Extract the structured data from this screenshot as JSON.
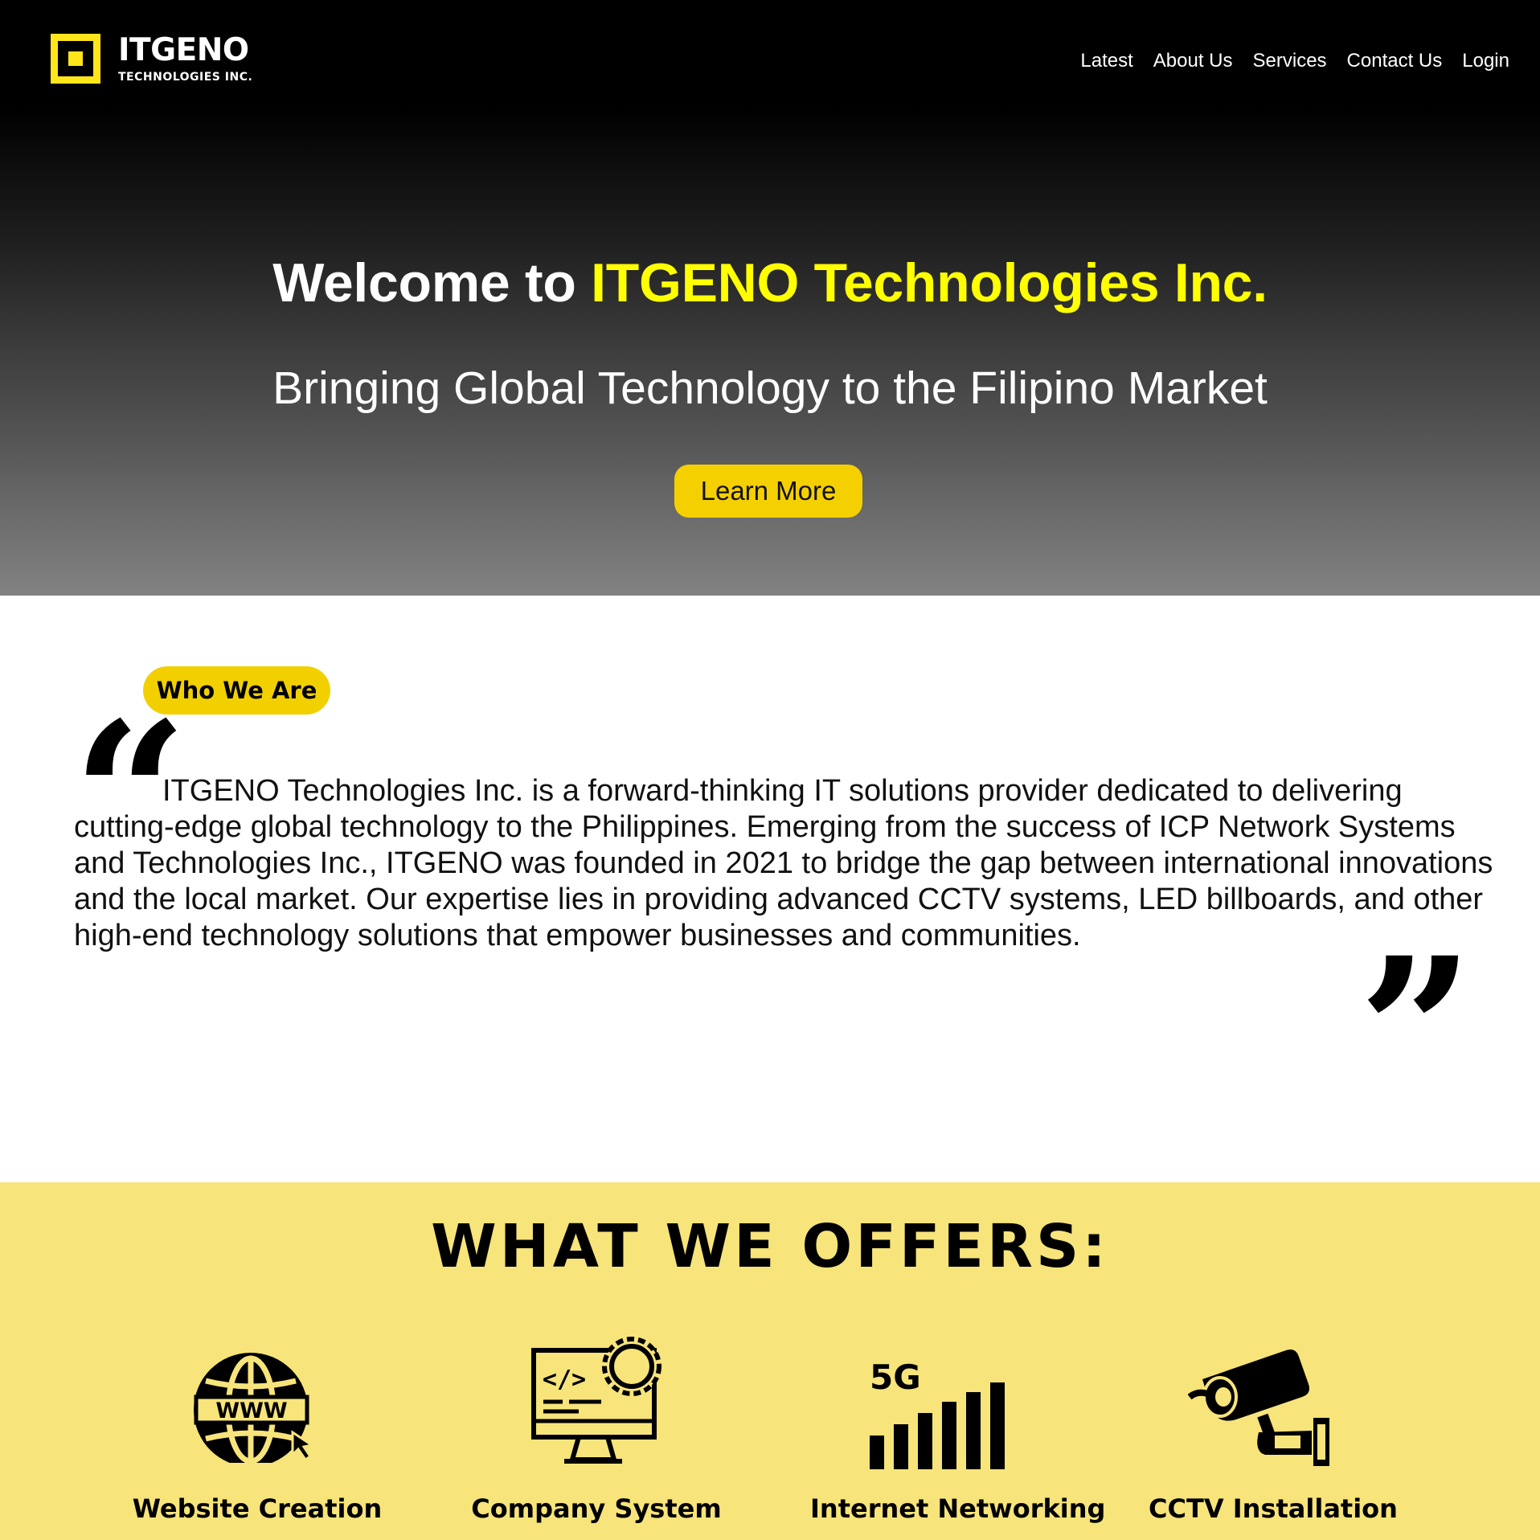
{
  "header": {
    "logo_name": "ITGENO",
    "logo_sub": "TECHNOLOGIES INC.",
    "nav": [
      "Latest",
      "About Us",
      "Services",
      "Contact Us",
      "Login"
    ]
  },
  "hero": {
    "title_prefix": "Welcome to ",
    "title_highlight": "ITGENO Technologies Inc.",
    "subtitle": "Bringing Global Technology to the Filipino Market",
    "cta": "Learn More"
  },
  "about": {
    "badge": "Who We Are",
    "text": "ITGENO Technologies Inc. is a forward-thinking IT solutions provider dedicated to delivering cutting-edge global technology to the Philippines. Emerging from the success of ICP Network Systems and Technologies Inc., ITGENO was founded in 2021 to bridge the gap between international innovations and the local market. Our expertise lies in providing advanced CCTV systems, LED billboards, and other high-end technology solutions that empower businesses and communities."
  },
  "offers": {
    "title": "WHAT WE OFFERS:",
    "items": [
      {
        "label": "Website Creation",
        "icon": "globe-www-icon"
      },
      {
        "label": "Company System",
        "icon": "monitor-code-gear-icon"
      },
      {
        "label": "Internet Networking",
        "icon": "signal-5g-icon"
      },
      {
        "label": "CCTV Installation",
        "icon": "cctv-camera-icon"
      }
    ],
    "icon_5g_text": "5G",
    "icon_www_text": "WWW"
  },
  "colors": {
    "accent_yellow": "#ffff00",
    "button_yellow": "#f5d000",
    "offers_bg": "#f7e47a"
  }
}
